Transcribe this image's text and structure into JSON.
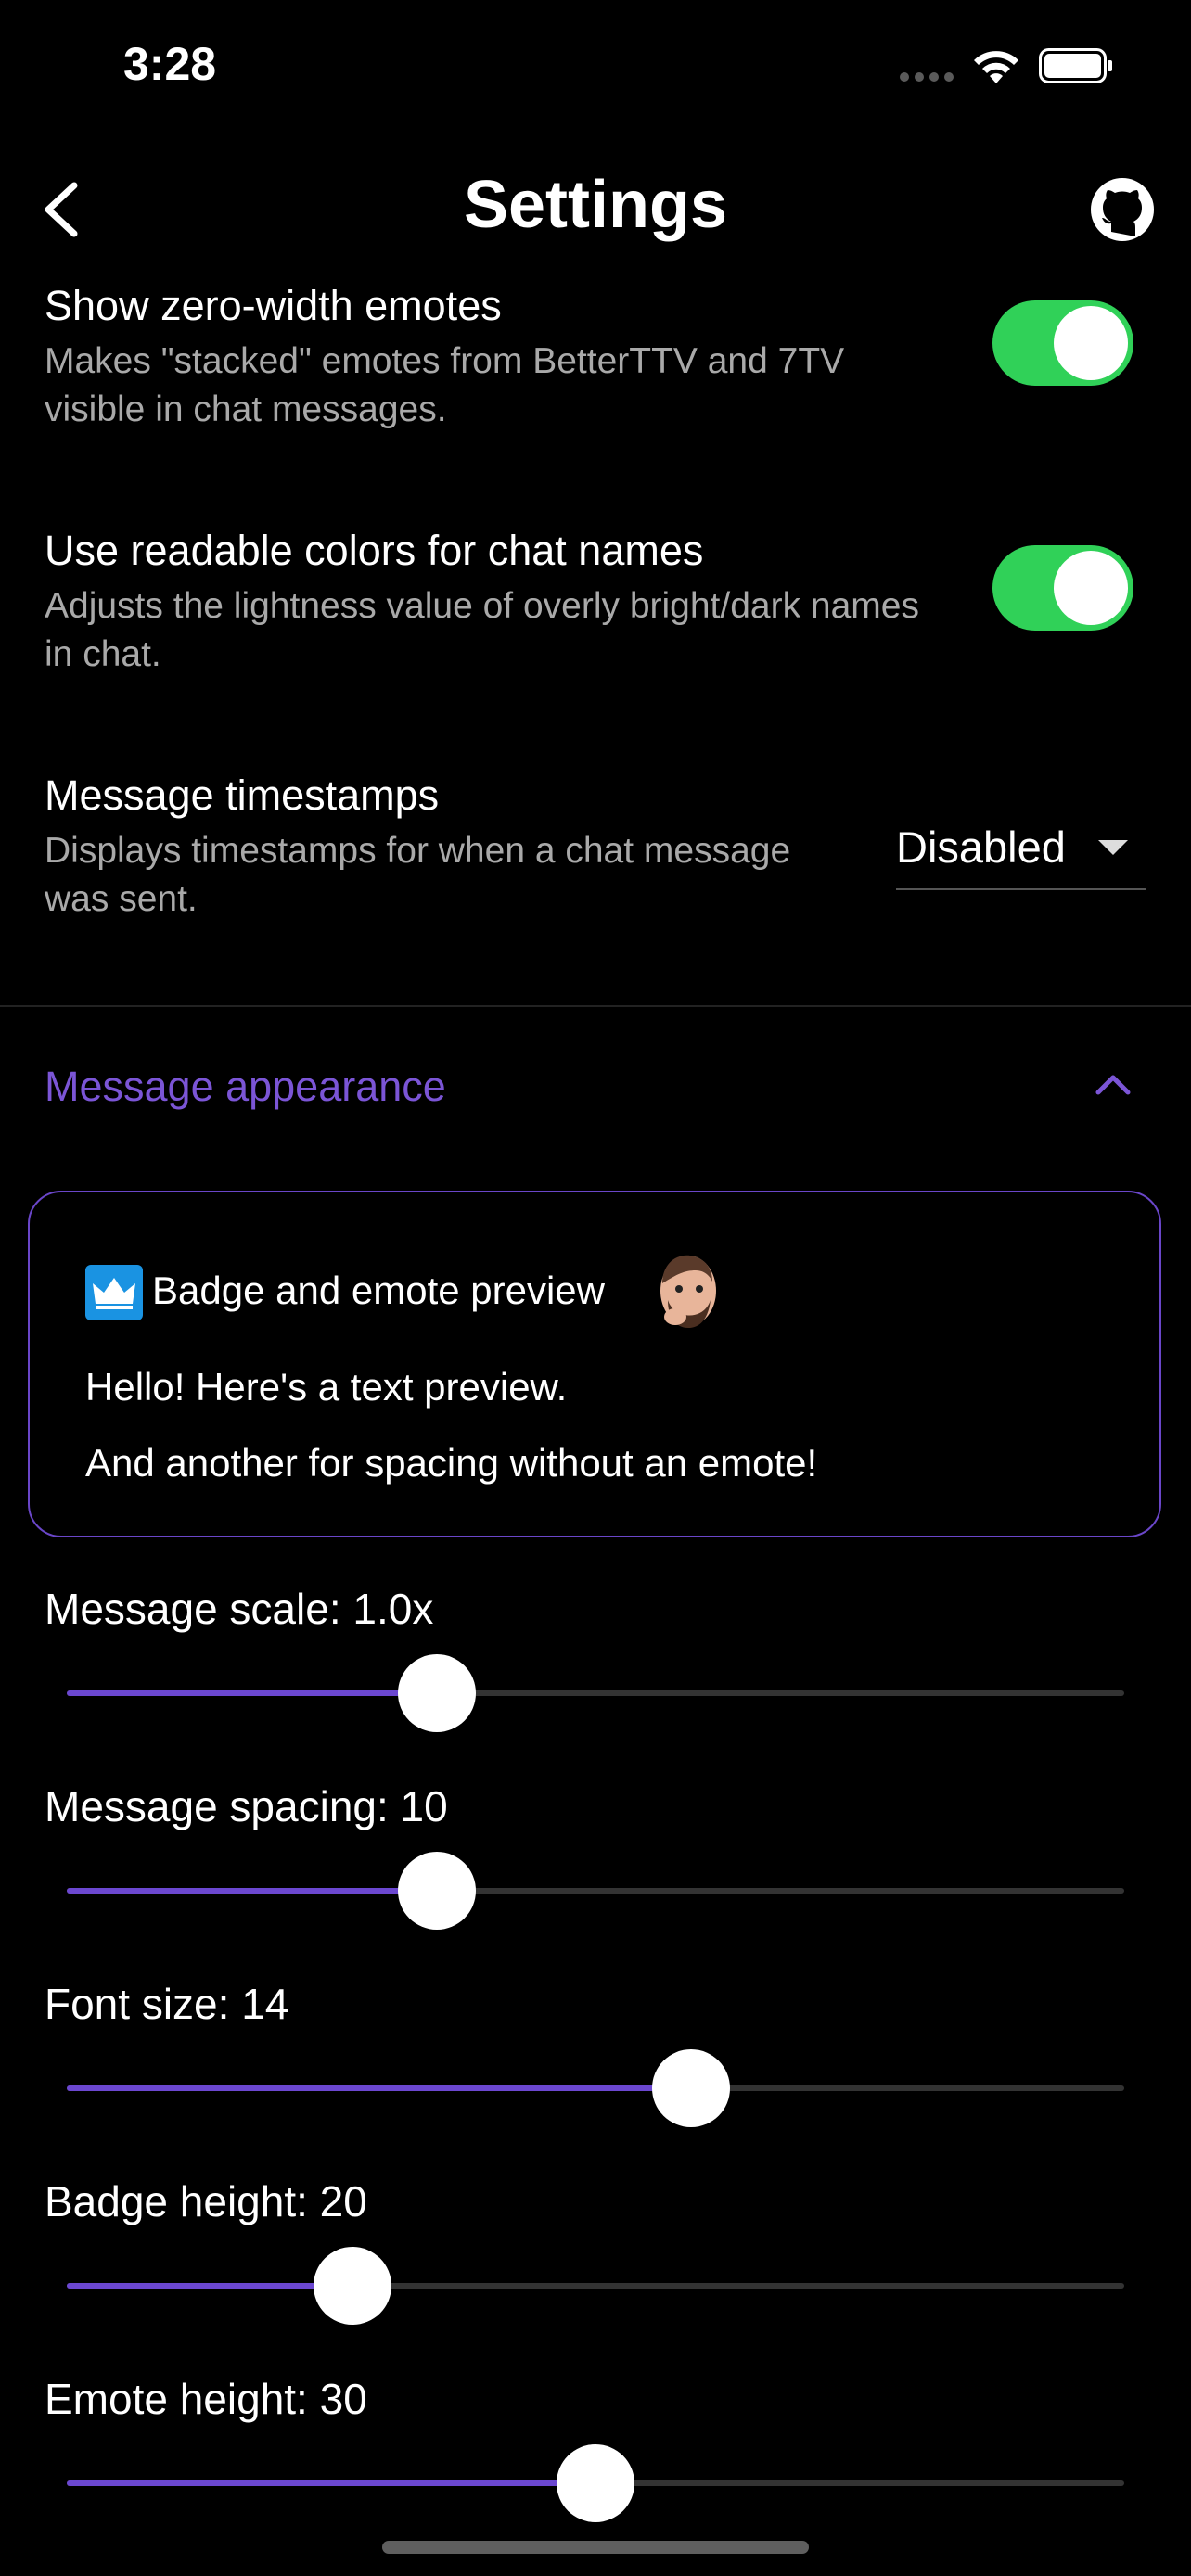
{
  "status_bar": {
    "time": "3:28"
  },
  "nav": {
    "title": "Settings"
  },
  "settings": {
    "zero_width": {
      "title": "Show zero-width emotes",
      "desc": "Makes \"stacked\" emotes from BetterTTV and 7TV visible in chat messages.",
      "enabled": true
    },
    "readable_colors": {
      "title": "Use readable colors for chat names",
      "desc": "Adjusts the lightness value of overly bright/dark names in chat.",
      "enabled": true
    },
    "timestamps": {
      "title": "Message timestamps",
      "desc": "Displays timestamps for when a chat message was sent.",
      "value": "Disabled"
    }
  },
  "section": {
    "title": "Message appearance"
  },
  "preview": {
    "line1": "Badge and emote preview",
    "line2": "Hello! Here's a text preview.",
    "line3": "And another for spacing without an emote!"
  },
  "sliders": [
    {
      "label": "Message scale: 1.0x",
      "fraction": 0.35
    },
    {
      "label": "Message spacing: 10",
      "fraction": 0.35
    },
    {
      "label": "Font size: 14",
      "fraction": 0.59
    },
    {
      "label": "Badge height: 20",
      "fraction": 0.27
    },
    {
      "label": "Emote height: 30",
      "fraction": 0.5
    }
  ],
  "colors": {
    "accent": "#6b47d0",
    "toggle_on": "#30d158",
    "section": "#7b55d6"
  }
}
